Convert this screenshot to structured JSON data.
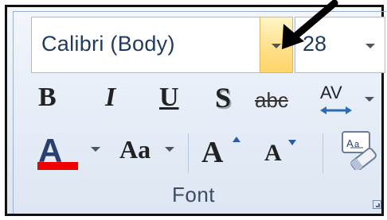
{
  "font_group": {
    "font_name": "Calibri (Body)",
    "font_size": "28",
    "label": "Font"
  },
  "buttons": {
    "bold": "B",
    "italic": "I",
    "underline": "U",
    "shadow": "S",
    "strikethrough": "abc",
    "character_spacing": "AV",
    "font_color": "A",
    "change_case": "Aa",
    "grow_font": "A",
    "shrink_font": "A"
  },
  "colors": {
    "font_color_bar": "#e00000",
    "dropdown_highlight": "#ffe08a"
  },
  "icons": [
    "arrow-cursor-icon",
    "dropdown-arrow-icon",
    "clear-formatting-icon",
    "dialog-launcher-icon"
  ]
}
